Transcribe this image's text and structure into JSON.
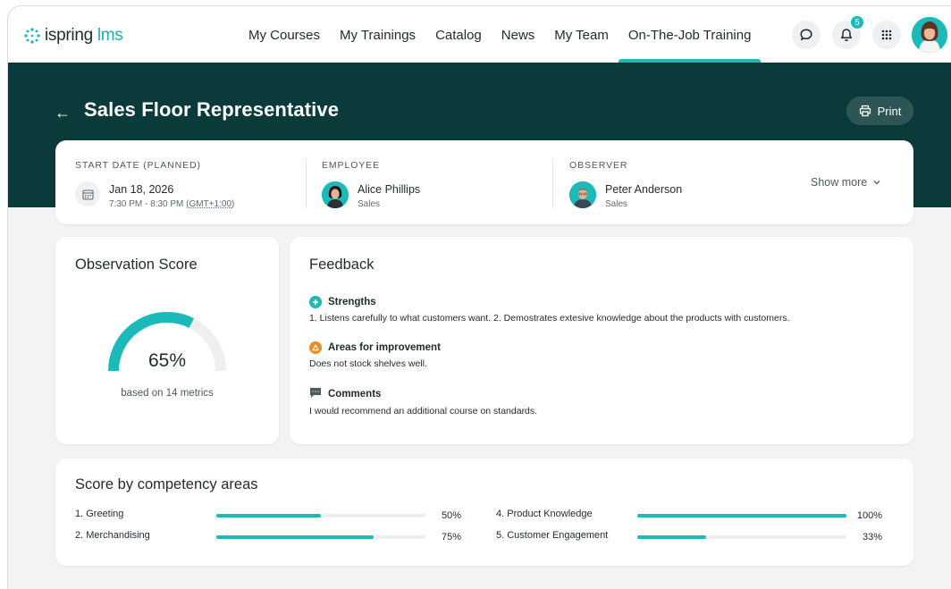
{
  "app": {
    "logo_brand": "ispring",
    "logo_product": "lms",
    "accent_color": "#1bbab9",
    "dark_color": "#0b3a3b"
  },
  "nav": {
    "items": [
      "My Courses",
      "My Trainings",
      "Catalog",
      "News",
      "My Team",
      "On-The-Job Training"
    ],
    "active": "On-The-Job Training"
  },
  "header_icons": {
    "chat": "chat-bubble-icon",
    "notifications": "bell-icon",
    "notification_count": "5",
    "apps": "apps-grid-icon"
  },
  "page": {
    "title": "Sales Floor Representative",
    "print_label": "Print"
  },
  "info": {
    "start_label": "START DATE (PLANNED)",
    "start_date": "Jan 18, 2026",
    "start_time": "7:30 PM - 8:30 PM",
    "timezone": "(GMT+1:00)",
    "employee_label": "EMPLOYEE",
    "employee_name": "Alice Phillips",
    "employee_dept": "Sales",
    "observer_label": "OBSERVER",
    "observer_name": "Peter Anderson",
    "observer_dept": "Sales",
    "show_more": "Show more"
  },
  "score": {
    "title": "Observation Score",
    "percent": 65,
    "value_label": "65%",
    "sub": "based on 14 metrics"
  },
  "feedback": {
    "title": "Feedback",
    "strengths_label": "Strengths",
    "strengths_text": "1. Listens carefully to what customers want. 2. Demostrates extesive knowledge about the products with customers.",
    "improve_label": "Areas for improvement",
    "improve_text": "Does not stock shelves well.",
    "comments_label": "Comments",
    "comments_text": "I would recommend an additional course on standards."
  },
  "competency": {
    "title": "Score by competency areas",
    "items": [
      {
        "label": "1.  Greeting",
        "value": 50,
        "pct": "50%"
      },
      {
        "label": "2.  Merchandising",
        "value": 75,
        "pct": "75%"
      },
      {
        "label": "4.  Product Knowledge",
        "value": 100,
        "pct": "100%"
      },
      {
        "label": "5.  Customer Engagement",
        "value": 33,
        "pct": "33%"
      }
    ]
  }
}
